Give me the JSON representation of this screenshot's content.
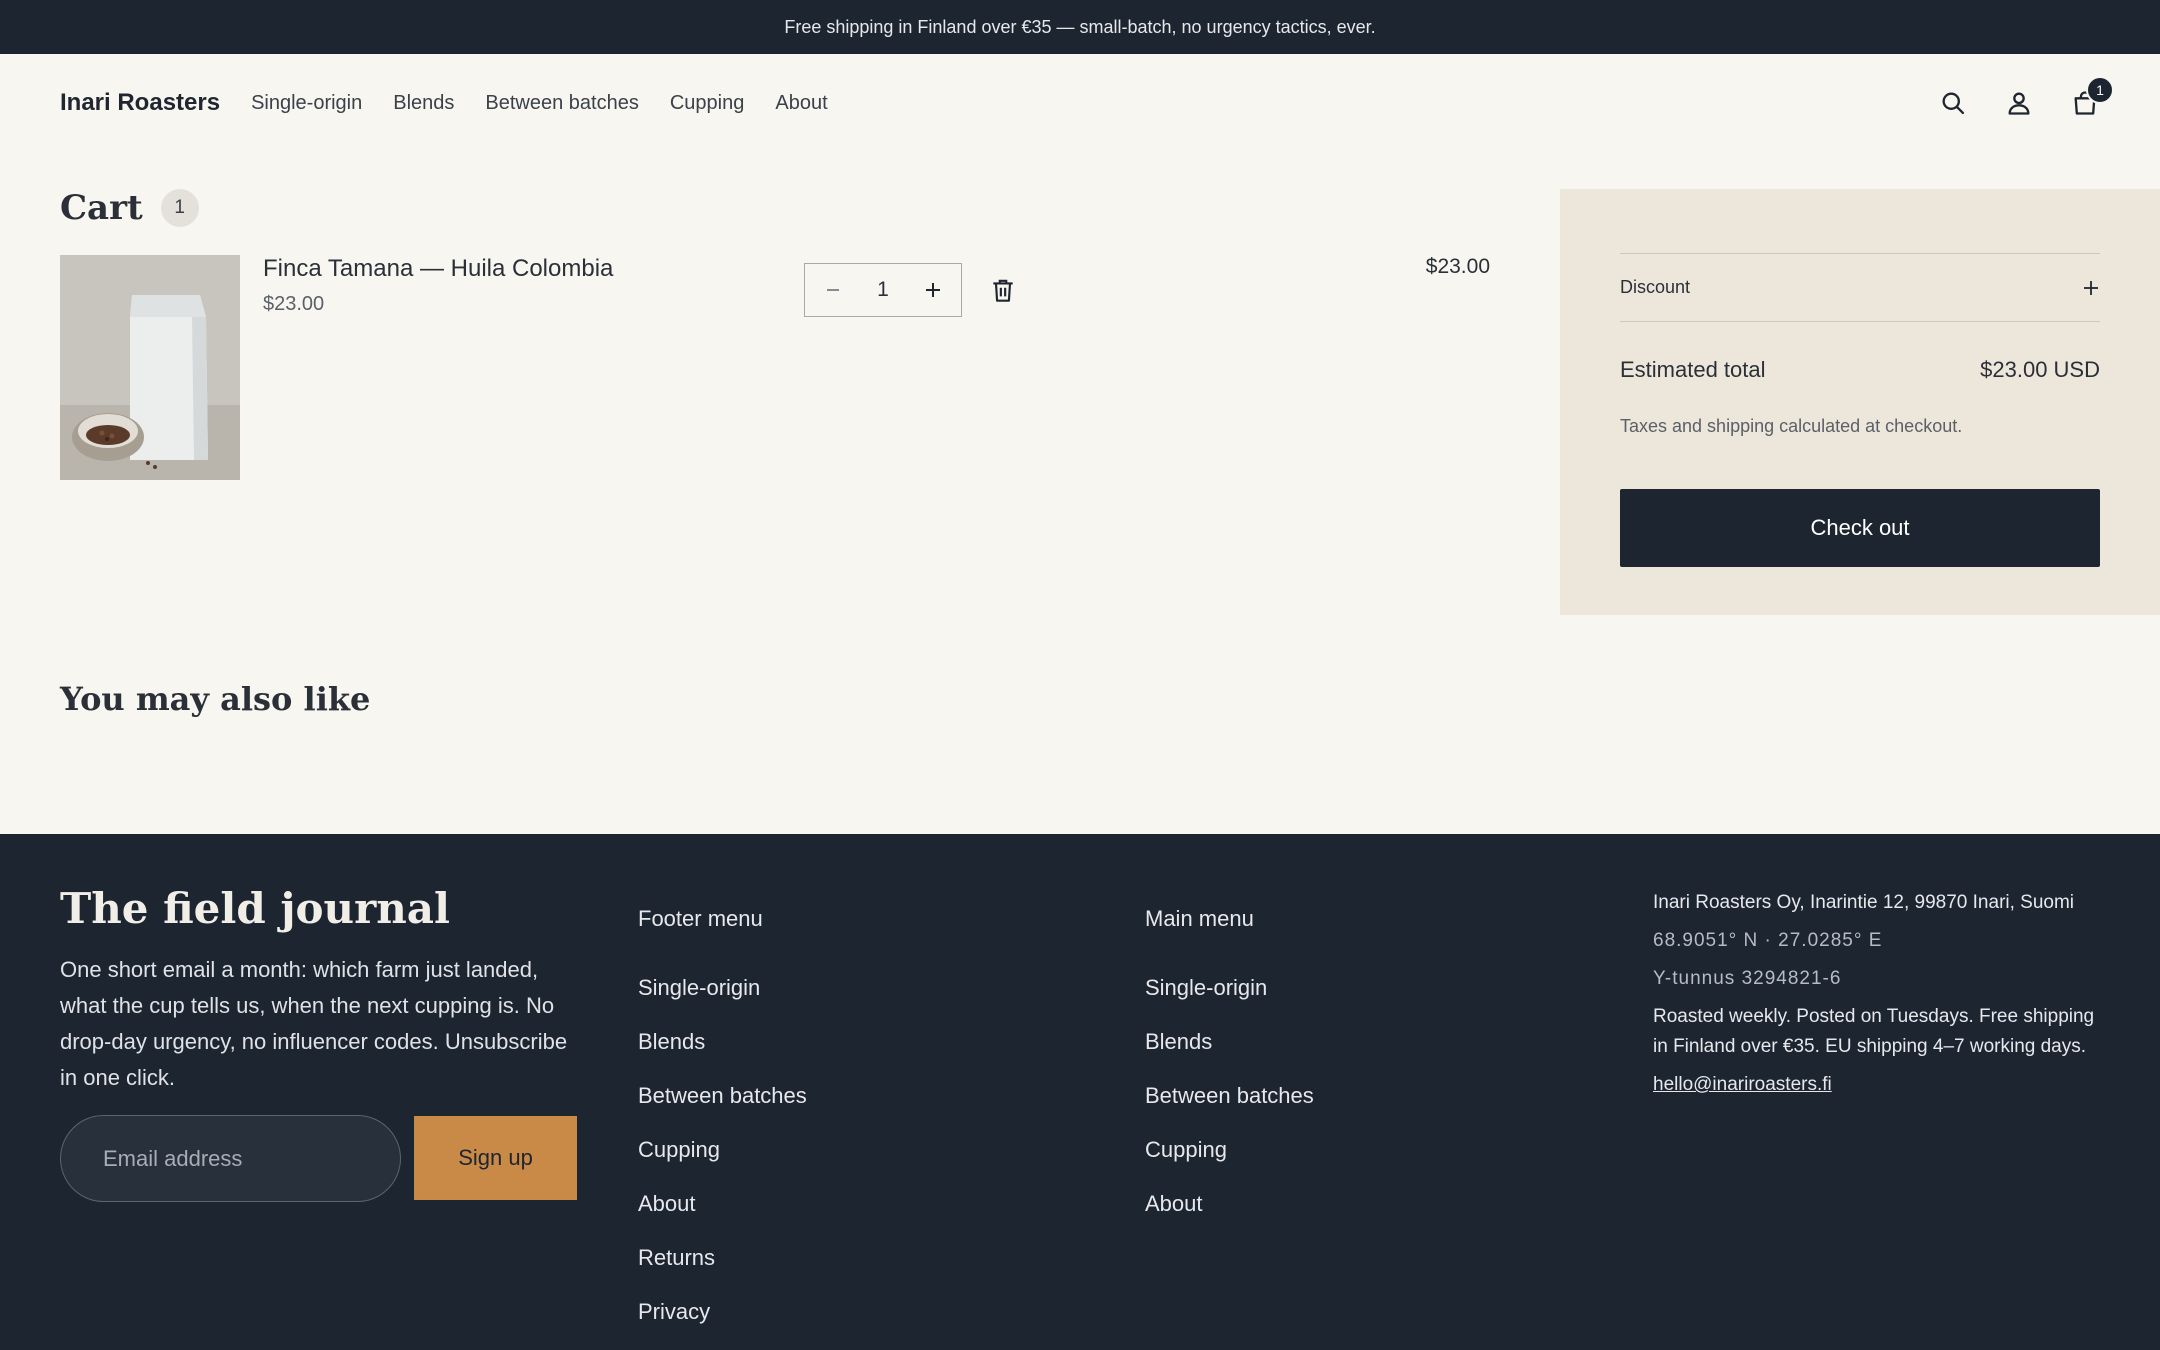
{
  "announcement": "Free shipping in Finland over €35 — small-batch, no urgency tactics, ever.",
  "header": {
    "brand": "Inari Roasters",
    "nav": [
      "Single-origin",
      "Blends",
      "Between batches",
      "Cupping",
      "About"
    ],
    "icons": [
      "search-icon",
      "account-icon",
      "cart-icon"
    ],
    "cart_count": "1"
  },
  "cart": {
    "title": "Cart",
    "count": "1",
    "items": [
      {
        "name": "Finca Tamana — Huila Colombia",
        "price": "$23.00",
        "quantity": "1",
        "line_total": "$23.00"
      }
    ]
  },
  "summary": {
    "discount_label": "Discount",
    "total_label": "Estimated total",
    "total_value": "$23.00 USD",
    "tax_note": "Taxes and shipping calculated at checkout.",
    "checkout_label": "Check out"
  },
  "recommendations": {
    "title": "You may also like"
  },
  "footer": {
    "journal_title": "The field journal",
    "journal_text": "One short email a month: which farm just landed, what the cup tells us, when the next cupping is. No drop-day urgency, no influencer codes. Unsubscribe in one click.",
    "email_placeholder": "Email address",
    "signup_label": "Sign up",
    "footer_menu": {
      "title": "Footer menu",
      "items": [
        "Single-origin",
        "Blends",
        "Between batches",
        "Cupping",
        "About",
        "Returns",
        "Privacy"
      ]
    },
    "main_menu": {
      "title": "Main menu",
      "items": [
        "Single-origin",
        "Blends",
        "Between batches",
        "Cupping",
        "About"
      ]
    },
    "address": "Inari Roasters Oy, Inarintie 12, 99870 Inari, Suomi",
    "coords": "68.9051° N · 27.0285° E",
    "business_id": "Y-tunnus 3294821-6",
    "shipping_note": "Roasted weekly. Posted on Tuesdays. Free shipping in Finland over €35. EU shipping 4–7 working days.",
    "email": "hello@inariroasters.fi"
  },
  "colors": {
    "dark": "#1d2530",
    "page_bg": "#f8f6f1",
    "summary_bg": "#ece7da",
    "accent": "#c98a48"
  }
}
